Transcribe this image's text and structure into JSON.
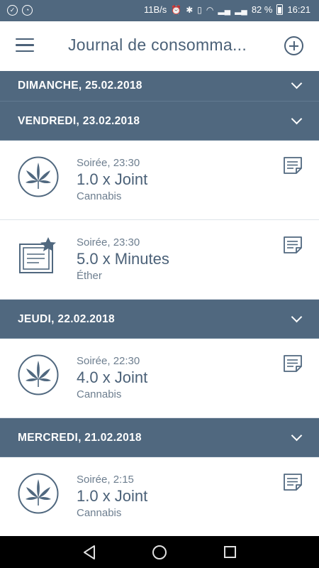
{
  "status_bar": {
    "network_speed": "11B/s",
    "battery": "82 %",
    "time": "16:21"
  },
  "app_bar": {
    "title": "Journal de consomma...",
    "menu_icon": "hamburger-icon",
    "add_icon": "plus-circle-icon"
  },
  "days": [
    {
      "label": "DIMANCHE, 25.02.2018",
      "entries": []
    },
    {
      "label": "VENDREDI, 23.02.2018",
      "entries": [
        {
          "time": "Soirée, 23:30",
          "amount": "1.0 x Joint",
          "substance": "Cannabis",
          "icon": "cannabis-leaf-icon"
        },
        {
          "time": "Soirée, 23:30",
          "amount": "5.0 x Minutes",
          "substance": "Éther",
          "icon": "clipboard-star-icon"
        }
      ]
    },
    {
      "label": "JEUDI, 22.02.2018",
      "entries": [
        {
          "time": "Soirée, 22:30",
          "amount": "4.0 x Joint",
          "substance": "Cannabis",
          "icon": "cannabis-leaf-icon"
        }
      ]
    },
    {
      "label": "MERCREDI, 21.02.2018",
      "entries": [
        {
          "time": "Soirée, 2:15",
          "amount": "1.0 x Joint",
          "substance": "Cannabis",
          "icon": "cannabis-leaf-icon"
        }
      ]
    }
  ],
  "colors": {
    "primary": "#50687f",
    "text_primary": "#4b6178",
    "text_secondary": "#6d7e8f"
  }
}
